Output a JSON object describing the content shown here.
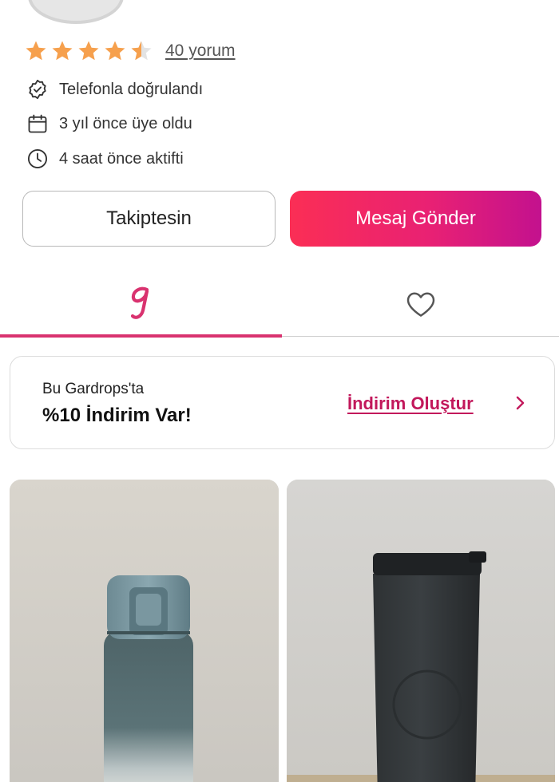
{
  "profile": {
    "rating": 4.5,
    "reviews_label": "40 yorum",
    "info": [
      {
        "icon": "verified-badge-icon",
        "text": "Telefonla doğrulandı"
      },
      {
        "icon": "calendar-icon",
        "text": "3 yıl önce üye oldu"
      },
      {
        "icon": "clock-icon",
        "text": "4 saat önce aktifti"
      }
    ]
  },
  "actions": {
    "follow_label": "Takiptesin",
    "message_label": "Mesaj Gönder"
  },
  "tabs": [
    {
      "id": "wardrobe",
      "icon": "gardrops-g-icon",
      "active": true
    },
    {
      "id": "likes",
      "icon": "heart-icon",
      "active": false
    }
  ],
  "promo": {
    "subtitle": "Bu Gardrops'ta",
    "title": "%10 İndirim Var!",
    "link_label": "İndirim Oluştur"
  },
  "products": [
    {
      "description": "blue-white thermos bottle photo"
    },
    {
      "description": "black travel tumbler photo"
    }
  ],
  "colors": {
    "accent": "#d9326f",
    "star": "#f6a04d",
    "button_gradient_start": "#fb2e55",
    "button_gradient_end": "#c3118e"
  }
}
